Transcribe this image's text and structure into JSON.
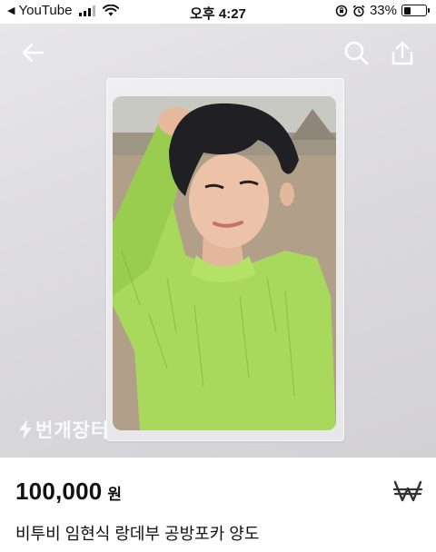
{
  "status_bar": {
    "back_glyph": "◀",
    "app": "YouTube",
    "time": "오후 4:27",
    "battery_text": "33%",
    "battery_level": 0.33,
    "icons": [
      "signal-icon",
      "wifi-icon",
      "rotation-lock-icon",
      "alarm-icon",
      "battery-icon"
    ]
  },
  "nav": {
    "icons": [
      "back-arrow-icon",
      "search-icon",
      "share-icon"
    ]
  },
  "image": {
    "watermark": "번개장터"
  },
  "product": {
    "price": "100,000",
    "currency": "원",
    "title": "비투비 임현식 랑데부 공방포카 양도",
    "pay_icon": "bunjang-pay-icon"
  }
}
